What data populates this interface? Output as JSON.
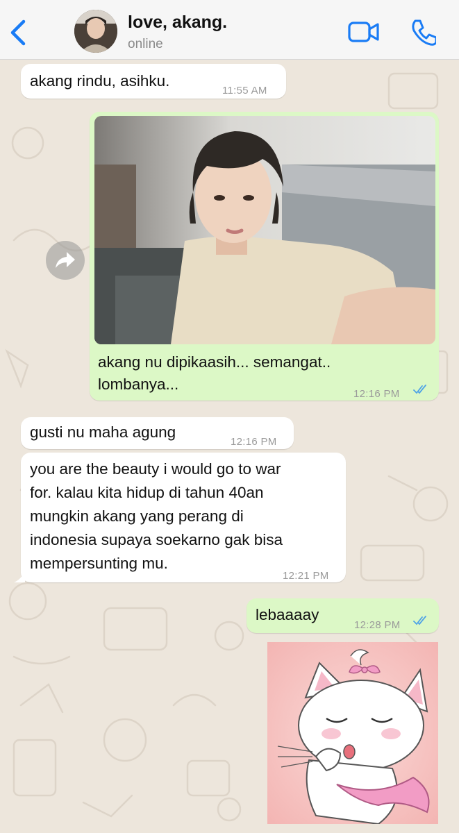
{
  "header": {
    "contact_name": "love, akang.",
    "status": "online",
    "back_icon": "chevron-left-icon",
    "video_icon": "video-camera-icon",
    "call_icon": "phone-icon",
    "accent_color": "#1a7cf5"
  },
  "messages": [
    {
      "direction": "incoming",
      "text": "akang rindu, asihku.",
      "time": "11:55 AM"
    },
    {
      "direction": "outgoing",
      "type": "image",
      "caption_line1": "akang nu dipikaasih... semangat..",
      "caption_line2": "lombanya...",
      "time": "12:16 PM",
      "status": "read"
    },
    {
      "direction": "incoming",
      "text": "gusti nu maha agung",
      "time": "12:16 PM"
    },
    {
      "direction": "incoming",
      "lines": [
        "you are the beauty i would go to war",
        "for. kalau kita hidup di tahun 40an",
        "mungkin akang yang perang di",
        "indonesia supaya soekarno gak bisa",
        "mempersunting mu."
      ],
      "time": "12:21 PM"
    },
    {
      "direction": "outgoing",
      "text": "lebaaaay",
      "time": "12:28 PM",
      "status": "read"
    },
    {
      "direction": "outgoing",
      "type": "sticker",
      "sticker": "white-kitten-kiss"
    }
  ],
  "colors": {
    "incoming_bubble": "#ffffff",
    "outgoing_bubble": "#dcf8c6",
    "read_ticks": "#4fa3e6",
    "wallpaper": "#ede6dc"
  }
}
